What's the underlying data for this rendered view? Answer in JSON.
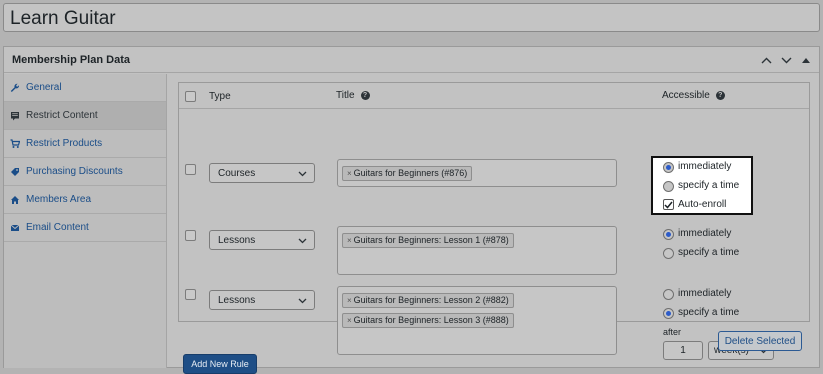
{
  "post_title": "Learn Guitar",
  "metabox": {
    "title": "Membership Plan Data"
  },
  "tabs": [
    {
      "label": "General",
      "icon": "wrench-icon"
    },
    {
      "label": "Restrict Content",
      "icon": "content-icon"
    },
    {
      "label": "Restrict Products",
      "icon": "cart-icon"
    },
    {
      "label": "Purchasing Discounts",
      "icon": "tag-icon"
    },
    {
      "label": "Members Area",
      "icon": "home-icon"
    },
    {
      "label": "Email Content",
      "icon": "email-icon"
    }
  ],
  "table": {
    "headers": {
      "type": "Type",
      "title": "Title",
      "accessible": "Accessible"
    },
    "help_glyph": "?"
  },
  "rules": [
    {
      "type": "Courses",
      "chips": [
        "Guitars for Beginners (#876)"
      ],
      "options": {
        "immediately": "immediately",
        "specify": "specify a time",
        "auto_enroll": "Auto-enroll"
      },
      "selected": "immediately",
      "auto_enroll": true
    },
    {
      "type": "Lessons",
      "chips": [
        "Guitars for Beginners: Lesson 1 (#878)"
      ],
      "options": {
        "immediately": "immediately",
        "specify": "specify a time"
      },
      "selected": "immediately"
    },
    {
      "type": "Lessons",
      "chips": [
        "Guitars for Beginners: Lesson 2 (#882)",
        "Guitars for Beginners: Lesson 3 (#888)"
      ],
      "options": {
        "immediately": "immediately",
        "specify": "specify a time"
      },
      "selected": "specify",
      "after_label": "after",
      "after_value": "1",
      "after_unit": "week(s)"
    }
  ],
  "chip_remove": "×",
  "buttons": {
    "add_rule": "Add New Rule",
    "delete_selected": "Delete Selected"
  },
  "colors": {
    "primary": "#1e4e86",
    "radio_selected": "#2c5bc9"
  }
}
